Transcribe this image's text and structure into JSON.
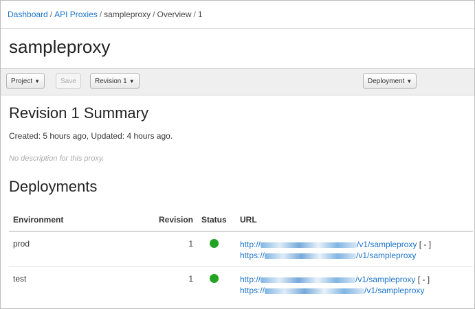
{
  "breadcrumb": {
    "items": [
      "Dashboard",
      "API Proxies",
      "sampleproxy",
      "Overview",
      "1"
    ],
    "separator": "/"
  },
  "proxy_name": "sampleproxy",
  "toolbar": {
    "project_label": "Project",
    "save_label": "Save",
    "revision_label": "Revision 1",
    "deployment_label": "Deployment"
  },
  "summary": {
    "title": "Revision 1 Summary",
    "meta": "Created: 5 hours ago, Updated: 4 hours ago.",
    "description": "No description for this proxy."
  },
  "deployments": {
    "title": "Deployments",
    "headers": [
      "Environment",
      "Revision",
      "Status",
      "URL"
    ],
    "rows": [
      {
        "environment": "prod",
        "revision": "1",
        "status": "deployed",
        "url_http_prefix": "http://",
        "url_http_suffix": "/v1/sampleproxy",
        "url_https_prefix": "https://",
        "url_https_suffix": "/v1/sampleproxy",
        "undeploy": "[ - ]"
      },
      {
        "environment": "test",
        "revision": "1",
        "status": "deployed",
        "url_http_prefix": "http://",
        "url_http_suffix": "/v1/sampleproxy",
        "url_https_prefix": "https://",
        "url_https_suffix": "/v1/sampleproxy",
        "undeploy": "[ - ]"
      }
    ]
  },
  "colors": {
    "link": "#1a73c9",
    "status_deployed": "#22a322",
    "toolbar_bg": "#efefef"
  }
}
